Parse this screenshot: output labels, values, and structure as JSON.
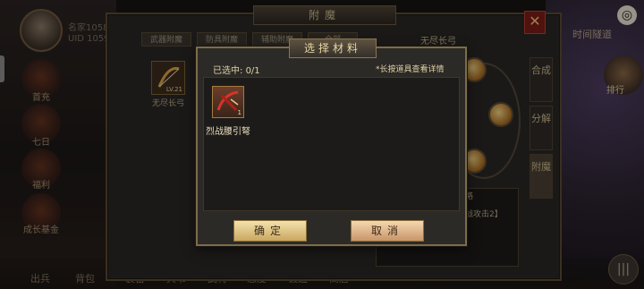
{
  "background": {
    "player": {
      "name": "名家10585…",
      "uid": "UID 10595731…"
    },
    "side_menu": [
      "首充",
      "七日",
      "福利",
      "成长基金"
    ],
    "bottom_menu": [
      "出兵",
      "背包",
      "装备",
      "兵书",
      "武将",
      "态度",
      "锻造",
      "商店"
    ],
    "main_panel": {
      "title": "附魔",
      "close_icon": "close-icon",
      "tabs": [
        "武器附魔",
        "防具附魔",
        "辅助附魔",
        "全部"
      ],
      "list_header": "无尽长弓",
      "equipped_item": {
        "name": "无尽长弓",
        "level": "LV.21"
      },
      "side_tabs": [
        "合成",
        "分解",
        "附魔"
      ],
      "description_fragment": "战攻击2】",
      "description_tail": "略"
    },
    "top_right": {
      "label": "时间隧道",
      "icon": "close-circle-icon",
      "rank_label": "排行"
    },
    "menu_button": "|||"
  },
  "dialog": {
    "title": "选择材料",
    "selected_label": "已选中",
    "selected_count": "0/1",
    "hint": "*长按道具查看详情",
    "materials": [
      {
        "name": "烈战腰引弩",
        "count": "1"
      }
    ],
    "confirm_label": "确定",
    "cancel_label": "取消"
  },
  "colors": {
    "accent_gold": "#c9a760",
    "panel_border": "#7d6c4a",
    "close_red": "#7a1d16"
  }
}
